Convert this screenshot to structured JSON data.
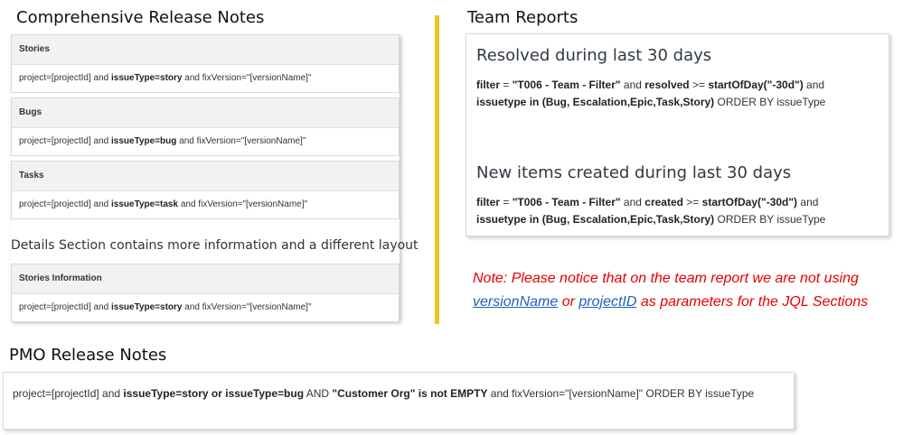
{
  "left": {
    "title": "Comprehensive Release Notes",
    "sections": [
      {
        "header": "Stories",
        "jql": {
          "p1": "project=[projectId] and ",
          "kw": "issueType=story",
          "p2": " and fixVersion=\"[versionName]\""
        }
      },
      {
        "header": "Bugs",
        "jql": {
          "p1": "project=[projectId] and ",
          "kw": "issueType=bug",
          "p2": " and fixVersion=\"[versionName]\""
        }
      },
      {
        "header": "Tasks",
        "jql": {
          "p1": "project=[projectId] and ",
          "kw": "issueType=task",
          "p2": " and fixVersion=\"[versionName]\""
        }
      }
    ],
    "details_note": "Details Section contains more information and a different layout",
    "details_section": {
      "header": "Stories Information",
      "jql": {
        "p1": "project=[projectId] and ",
        "kw": "issueType=story",
        "p2": " and fixVersion=\"[versionName]\""
      }
    }
  },
  "right": {
    "title": "Team Reports",
    "blocks": [
      {
        "title": "Resolved during last 30 days",
        "line1": {
          "b1": "filter",
          "t1": " = ",
          "b2": "\"T006 - Team - Filter\"",
          "t2": " and ",
          "b3": "resolved",
          "t3": " >= ",
          "b4": "startOfDay(\"-30d\")",
          "t4": " and"
        },
        "line2": {
          "b1": "issuetype in (Bug, Escalation,Epic,Task,Story)",
          "t1": " ORDER BY issueType"
        }
      },
      {
        "title": "New items created during last 30 days",
        "line1": {
          "b1": "filter",
          "t1": " = ",
          "b2": "\"T006 - Team - Filter\"",
          "t2": " and ",
          "b3": "created",
          "t3": " >= ",
          "b4": "startOfDay(\"-30d\")",
          "t4": " and"
        },
        "line2": {
          "b1": "issuetype in (Bug, Escalation,Epic,Task,Story)",
          "t1": " ORDER BY issueType"
        }
      }
    ],
    "note": {
      "prefix": "Note: Please notice that on the team report we are not using ",
      "link1": "versionName",
      "mid": " or ",
      "link2": "projectID",
      "suffix": " as parameters for the JQL Sections"
    }
  },
  "pmo": {
    "title": "PMO Release Notes",
    "jql": {
      "t1": "project=[projectId] and ",
      "b1": "issueType=story or issueType=bug",
      "t2": " AND ",
      "b2": "\"Customer Org\" is not EMPTY",
      "t3": "  and fixVersion=\"[versionName]\" ORDER BY issueType"
    }
  },
  "colors": {
    "divider": "#f2c21b",
    "note_text": "#e60000",
    "note_link": "#1f5fbf"
  }
}
